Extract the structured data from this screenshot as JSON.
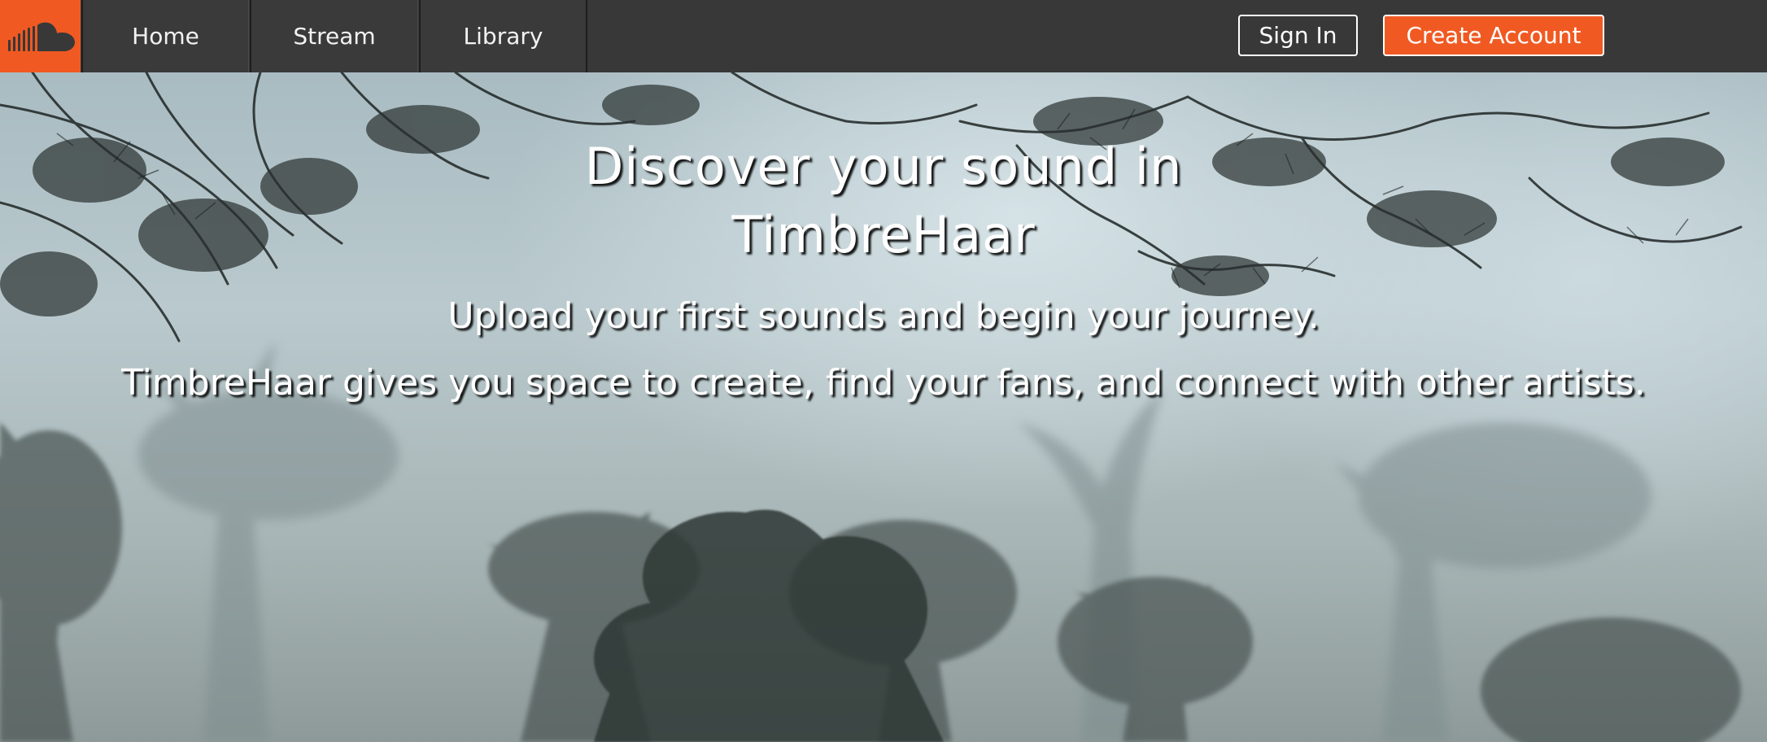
{
  "nav": {
    "logo_icon": "cloud-logo-icon",
    "tabs": [
      {
        "label": "Home"
      },
      {
        "label": "Stream"
      },
      {
        "label": "Library"
      }
    ],
    "signin_label": "Sign In",
    "create_account_label": "Create Account"
  },
  "hero": {
    "headline": "Discover your sound in TimbreHaar",
    "subtitle_line1": "Upload your first sounds and begin your journey.",
    "subtitle_line2": "TimbreHaar gives you space to create, find your fans, and connect with other artists.",
    "background": "misty-forest-image"
  },
  "colors": {
    "brand_orange": "#f05a22",
    "navbar_bg": "#383838",
    "text_white": "#ffffff"
  }
}
